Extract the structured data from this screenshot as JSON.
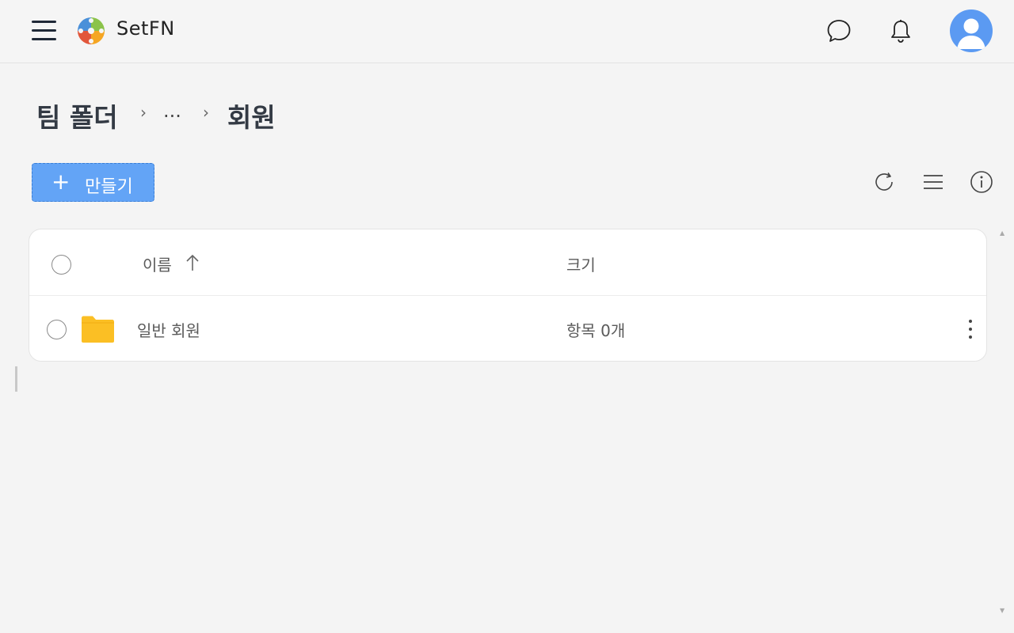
{
  "header": {
    "brand": "SetFN",
    "icons": [
      "menu-icon",
      "logo-icon",
      "chat-icon",
      "bell-icon",
      "avatar"
    ]
  },
  "breadcrumb": {
    "root": "팀 폴더",
    "ellipsis": "...",
    "current": "회원"
  },
  "toolbar": {
    "create_label": "만들기",
    "create_icon": "plus-icon",
    "icons": [
      "refresh-icon",
      "list-view-icon",
      "info-icon"
    ]
  },
  "table": {
    "columns": {
      "name": "이름",
      "size": "크기"
    },
    "sort": "name-ascending",
    "rows": [
      {
        "name": "일반 회원",
        "size": "항목 0개",
        "icon": "folder-icon"
      }
    ]
  },
  "colors": {
    "accent": "#63a4f6",
    "folder": "#fbbf24",
    "avatar": "#5b9af2",
    "background": "#f4f4f4"
  }
}
